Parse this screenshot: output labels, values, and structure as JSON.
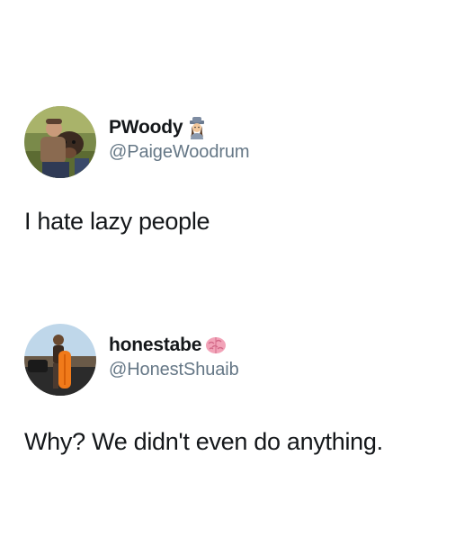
{
  "tweets": [
    {
      "display_name": "PWoody",
      "handle": "@PaigeWoodrum",
      "emoji": "detective-emoji",
      "text": "I hate lazy people"
    },
    {
      "display_name": "honestabe",
      "handle": "@HonestShuaib",
      "emoji": "brain-emoji",
      "text": "Why? We didn't even do anything."
    }
  ]
}
